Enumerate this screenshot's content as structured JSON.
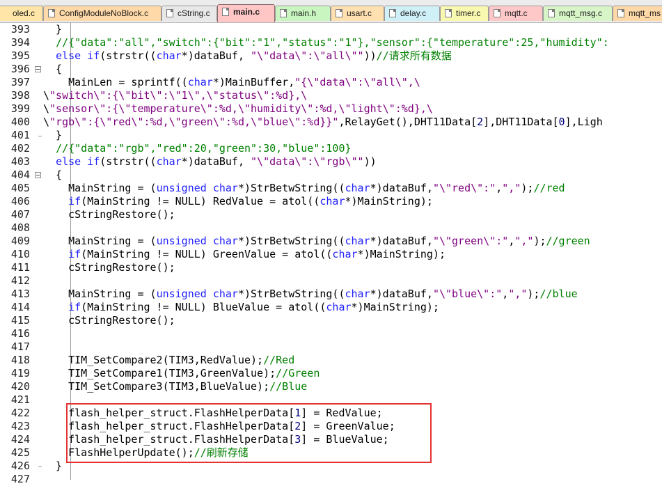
{
  "tabs": [
    {
      "label": "oled.c",
      "color": "#ffe6a8"
    },
    {
      "label": "ConfigModuleNoBlock.c",
      "color": "#ffd9a8"
    },
    {
      "label": "cString.c",
      "color": "#e8e8e8"
    },
    {
      "label": "main.c",
      "color": "#ffc6c6",
      "active": true
    },
    {
      "label": "main.h",
      "color": "#c8f5c0"
    },
    {
      "label": "usart.c",
      "color": "#ffe0b0"
    },
    {
      "label": "delay.c",
      "color": "#d0f0f8"
    },
    {
      "label": "timer.c",
      "color": "#f8f8b0"
    },
    {
      "label": "mqtt.c",
      "color": "#ffc8c8"
    },
    {
      "label": "mqtt_msg.c",
      "color": "#d8f5c8"
    },
    {
      "label": "mqtt_ms",
      "color": "#ffd8a8"
    }
  ],
  "code_lines": [
    {
      "n": "393",
      "t": "  }"
    },
    {
      "n": "394",
      "t": "  //{\"data\":\"all\",\"switch\":{\"bit\":\"1\",\"status\":\"1\"},\"sensor\":{\"temperature\":25,\"humidity\":"
    },
    {
      "n": "395",
      "t": "  else if(strstr((char*)dataBuf, \"\\\"data\\\":\\\"all\\\"\"))//请求所有数据"
    },
    {
      "n": "396",
      "t": "  {"
    },
    {
      "n": "397",
      "t": "    MainLen = sprintf((char*)MainBuffer,\"{\\\"data\\\":\\\"all\\\",\\"
    },
    {
      "n": "398",
      "t": "\\\"switch\\\":{\\\"bit\\\":\\\"1\\\",\\\"status\\\":%d},\\"
    },
    {
      "n": "399",
      "t": "\\\"sensor\\\":{\\\"temperature\\\":%d,\\\"humidity\\\":%d,\\\"light\\\":%d},\\"
    },
    {
      "n": "400",
      "t": "\\\"rgb\\\":{\\\"red\\\":%d,\\\"green\\\":%d,\\\"blue\\\":%d}}\",RelayGet(),DHT11Data[2],DHT11Data[0],Ligh"
    },
    {
      "n": "401",
      "t": "  }"
    },
    {
      "n": "402",
      "t": "  //{\"data\":\"rgb\",\"red\":20,\"green\":30,\"blue\":100}"
    },
    {
      "n": "403",
      "t": "  else if(strstr((char*)dataBuf, \"\\\"data\\\":\\\"rgb\\\"\"))"
    },
    {
      "n": "404",
      "t": "  {"
    },
    {
      "n": "405",
      "t": "    MainString = (unsigned char*)StrBetwString((char*)dataBuf,\"\\\"red\\\":\",\",\");//red"
    },
    {
      "n": "406",
      "t": "    if(MainString != NULL) RedValue = atol((char*)MainString);"
    },
    {
      "n": "407",
      "t": "    cStringRestore();"
    },
    {
      "n": "408",
      "t": ""
    },
    {
      "n": "409",
      "t": "    MainString = (unsigned char*)StrBetwString((char*)dataBuf,\"\\\"green\\\":\",\",\");//green"
    },
    {
      "n": "410",
      "t": "    if(MainString != NULL) GreenValue = atol((char*)MainString);"
    },
    {
      "n": "411",
      "t": "    cStringRestore();"
    },
    {
      "n": "412",
      "t": ""
    },
    {
      "n": "413",
      "t": "    MainString = (unsigned char*)StrBetwString((char*)dataBuf,\"\\\"blue\\\":\",\",\");//blue"
    },
    {
      "n": "414",
      "t": "    if(MainString != NULL) BlueValue = atol((char*)MainString);"
    },
    {
      "n": "415",
      "t": "    cStringRestore();"
    },
    {
      "n": "416",
      "t": ""
    },
    {
      "n": "417",
      "t": ""
    },
    {
      "n": "418",
      "t": "    TIM_SetCompare2(TIM3,RedValue);//Red"
    },
    {
      "n": "419",
      "t": "    TIM_SetCompare1(TIM3,GreenValue);//Green"
    },
    {
      "n": "420",
      "t": "    TIM_SetCompare3(TIM3,BlueValue);//Blue"
    },
    {
      "n": "421",
      "t": ""
    },
    {
      "n": "422",
      "t": "    flash_helper_struct.FlashHelperData[1] = RedValue;"
    },
    {
      "n": "423",
      "t": "    flash_helper_struct.FlashHelperData[2] = GreenValue;"
    },
    {
      "n": "424",
      "t": "    flash_helper_struct.FlashHelperData[3] = BlueValue;"
    },
    {
      "n": "425",
      "t": "    FlashHelperUpdate();//刷新存储"
    },
    {
      "n": "426",
      "t": "  }"
    },
    {
      "n": "427",
      "t": ""
    }
  ],
  "fold_lines": [
    "396",
    "404"
  ],
  "highlight_color": "#e53333",
  "syntax_colors": {
    "keyword": "#2020ff",
    "string": "#7f007f",
    "comment": "#008000",
    "number": "#000080"
  }
}
